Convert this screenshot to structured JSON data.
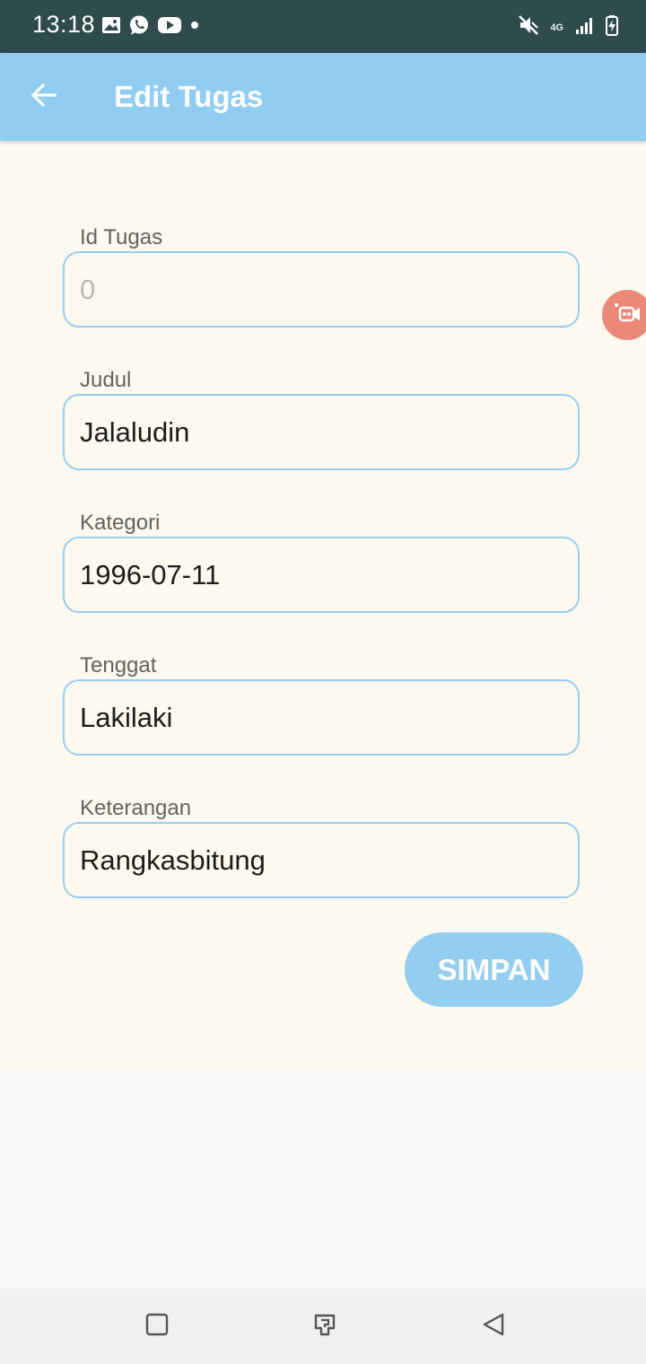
{
  "status_bar": {
    "time": "13:18",
    "network": "4G",
    "icons": [
      "image-icon",
      "whatsapp-icon",
      "youtube-icon",
      "notification-dot-icon",
      "mute-icon",
      "signal-icon",
      "battery-charging-icon"
    ]
  },
  "app_bar": {
    "title": "Edit Tugas",
    "back_icon": "arrow-left-icon",
    "background": "#90cdf0"
  },
  "form": {
    "fields": [
      {
        "label": "Id Tugas",
        "value": "0",
        "is_placeholder": true
      },
      {
        "label": "Judul",
        "value": "Jalaludin"
      },
      {
        "label": "Kategori",
        "value": "1996-07-11"
      },
      {
        "label": "Tenggat",
        "value": "Lakilaki"
      },
      {
        "label": "Keterangan",
        "value": "Rangkasbitung"
      }
    ],
    "save_label": "SIMPAN",
    "accent": "#93cdef"
  },
  "floating_button": {
    "icon": "screen-recorder-icon",
    "color": "#ec8878"
  },
  "nav_bar": {
    "icons": [
      "recents-square-icon",
      "home-icon",
      "back-triangle-icon"
    ]
  }
}
